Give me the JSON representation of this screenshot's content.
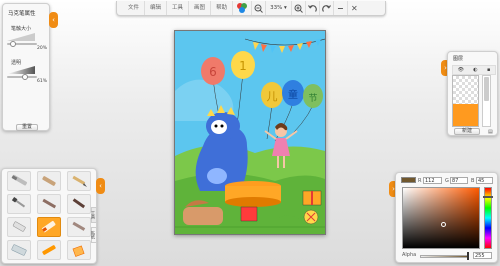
{
  "toolbar": {
    "menus": [
      "文件",
      "编辑",
      "工具",
      "画图",
      "帮助"
    ],
    "zoom": "33%",
    "icons": [
      "color-picker-icon",
      "zoom-out-icon",
      "zoom-in-icon",
      "undo-icon",
      "redo-icon",
      "minimize-icon",
      "close-icon"
    ]
  },
  "brush_panel": {
    "title": "马克笔属性",
    "size_label": "笔触大小",
    "size_value": "20%",
    "opacity_label": "透明",
    "opacity_value": "61%",
    "reset_label": "重置",
    "size_level": 0.2,
    "opacity_level": 0.61
  },
  "tool_panel": {
    "tools": [
      "marker",
      "crayon",
      "pencil",
      "brush",
      "roller",
      "pen",
      "eraser",
      "marker-orange",
      "smudge",
      "eraser-block",
      "crayon-orange",
      "fill-bucket"
    ],
    "selected_tool": "marker-orange",
    "side_tabs": [
      "工具",
      "贴纸"
    ]
  },
  "layer_panel": {
    "title": "图层",
    "new_label": "新建"
  },
  "color_panel": {
    "r": "112",
    "g": "87",
    "b": "45",
    "alpha_label": "Alpha",
    "alpha_value": "255",
    "current_color": "#70572d",
    "accent": "#f08c14"
  },
  "canvas": {
    "balloon_letters": [
      "6",
      "1",
      "儿",
      "童",
      "节"
    ]
  }
}
